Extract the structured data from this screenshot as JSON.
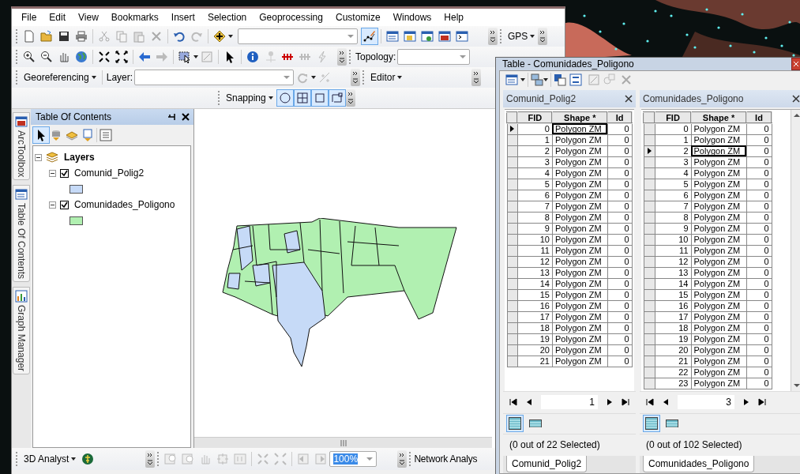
{
  "menu": [
    "File",
    "Edit",
    "View",
    "Bookmarks",
    "Insert",
    "Selection",
    "Geoprocessing",
    "Customize",
    "Windows",
    "Help"
  ],
  "toolbars": {
    "gps": "GPS",
    "topology": "Topology:",
    "georeferencing": "Georeferencing",
    "layer": "Layer:",
    "editor": "Editor",
    "snapping": "Snapping",
    "analyst_3d": "3D Analyst",
    "zoom_value": "100%",
    "network": "Network Analys"
  },
  "side_tabs": [
    {
      "label": "ArcToolbox"
    },
    {
      "label": "Table Of Contents"
    },
    {
      "label": "Graph Manager"
    }
  ],
  "toc": {
    "title": "Table Of Contents",
    "root": {
      "label": "Layers",
      "expanded": true,
      "children": [
        {
          "label": "Comunid_Polig2",
          "checked": true,
          "expanded": true,
          "color": "#c6daf7"
        },
        {
          "label": "Comunidades_Poligono",
          "checked": true,
          "expanded": true,
          "color": "#b1f0b1"
        }
      ]
    }
  },
  "table_window": {
    "title": "Table - Comunidades_Poligono",
    "panes": [
      {
        "title": "Comunid_Polig2",
        "columns": [
          "FID",
          "Shape *",
          "Id"
        ],
        "page": "1",
        "status": "(0 out of 22 Selected)",
        "tab": "Comunid_Polig2",
        "view_buttons": [
          {
            "selected": true
          },
          {
            "selected": false
          }
        ],
        "rows": [
          {
            "cells": [
              "0",
              "Polygon ZM",
              "0"
            ],
            "current": true
          },
          {
            "cells": [
              "1",
              "Polygon ZM",
              "0"
            ],
            "current": false
          },
          {
            "cells": [
              "2",
              "Polygon ZM",
              "0"
            ],
            "current": false
          },
          {
            "cells": [
              "3",
              "Polygon ZM",
              "0"
            ],
            "current": false
          },
          {
            "cells": [
              "4",
              "Polygon ZM",
              "0"
            ],
            "current": false
          },
          {
            "cells": [
              "5",
              "Polygon ZM",
              "0"
            ],
            "current": false
          },
          {
            "cells": [
              "6",
              "Polygon ZM",
              "0"
            ],
            "current": false
          },
          {
            "cells": [
              "7",
              "Polygon ZM",
              "0"
            ],
            "current": false
          },
          {
            "cells": [
              "8",
              "Polygon ZM",
              "0"
            ],
            "current": false
          },
          {
            "cells": [
              "9",
              "Polygon ZM",
              "0"
            ],
            "current": false
          },
          {
            "cells": [
              "10",
              "Polygon ZM",
              "0"
            ],
            "current": false
          },
          {
            "cells": [
              "11",
              "Polygon ZM",
              "0"
            ],
            "current": false
          },
          {
            "cells": [
              "12",
              "Polygon ZM",
              "0"
            ],
            "current": false
          },
          {
            "cells": [
              "13",
              "Polygon ZM",
              "0"
            ],
            "current": false
          },
          {
            "cells": [
              "14",
              "Polygon ZM",
              "0"
            ],
            "current": false
          },
          {
            "cells": [
              "15",
              "Polygon ZM",
              "0"
            ],
            "current": false
          },
          {
            "cells": [
              "16",
              "Polygon ZM",
              "0"
            ],
            "current": false
          },
          {
            "cells": [
              "17",
              "Polygon ZM",
              "0"
            ],
            "current": false
          },
          {
            "cells": [
              "18",
              "Polygon ZM",
              "0"
            ],
            "current": false
          },
          {
            "cells": [
              "19",
              "Polygon ZM",
              "0"
            ],
            "current": false
          },
          {
            "cells": [
              "20",
              "Polygon ZM",
              "0"
            ],
            "current": false
          },
          {
            "cells": [
              "21",
              "Polygon ZM",
              "0"
            ],
            "current": false
          }
        ]
      },
      {
        "title": "Comunidades_Poligono",
        "columns": [
          "FID",
          "Shape *",
          "Id"
        ],
        "page": "3",
        "status": "(0 out of 102 Selected)",
        "tab": "Comunidades_Poligono",
        "view_buttons": [
          {
            "selected": true
          },
          {
            "selected": false
          }
        ],
        "rows": [
          {
            "cells": [
              "0",
              "Polygon ZM",
              "0"
            ],
            "current": false
          },
          {
            "cells": [
              "1",
              "Polygon ZM",
              "0"
            ],
            "current": false
          },
          {
            "cells": [
              "2",
              "Polygon ZM",
              "0"
            ],
            "current": true
          },
          {
            "cells": [
              "3",
              "Polygon ZM",
              "0"
            ],
            "current": false
          },
          {
            "cells": [
              "4",
              "Polygon ZM",
              "0"
            ],
            "current": false
          },
          {
            "cells": [
              "5",
              "Polygon ZM",
              "0"
            ],
            "current": false
          },
          {
            "cells": [
              "6",
              "Polygon ZM",
              "0"
            ],
            "current": false
          },
          {
            "cells": [
              "7",
              "Polygon ZM",
              "0"
            ],
            "current": false
          },
          {
            "cells": [
              "8",
              "Polygon ZM",
              "0"
            ],
            "current": false
          },
          {
            "cells": [
              "9",
              "Polygon ZM",
              "0"
            ],
            "current": false
          },
          {
            "cells": [
              "10",
              "Polygon ZM",
              "0"
            ],
            "current": false
          },
          {
            "cells": [
              "11",
              "Polygon ZM",
              "0"
            ],
            "current": false
          },
          {
            "cells": [
              "12",
              "Polygon ZM",
              "0"
            ],
            "current": false
          },
          {
            "cells": [
              "13",
              "Polygon ZM",
              "0"
            ],
            "current": false
          },
          {
            "cells": [
              "14",
              "Polygon ZM",
              "0"
            ],
            "current": false
          },
          {
            "cells": [
              "15",
              "Polygon ZM",
              "0"
            ],
            "current": false
          },
          {
            "cells": [
              "16",
              "Polygon ZM",
              "0"
            ],
            "current": false
          },
          {
            "cells": [
              "17",
              "Polygon ZM",
              "0"
            ],
            "current": false
          },
          {
            "cells": [
              "18",
              "Polygon ZM",
              "0"
            ],
            "current": false
          },
          {
            "cells": [
              "19",
              "Polygon ZM",
              "0"
            ],
            "current": false
          },
          {
            "cells": [
              "20",
              "Polygon ZM",
              "0"
            ],
            "current": false
          },
          {
            "cells": [
              "21",
              "Polygon ZM",
              "0"
            ],
            "current": false
          },
          {
            "cells": [
              "22",
              "Polygon ZM",
              "0"
            ],
            "current": false
          },
          {
            "cells": [
              "23",
              "Polygon ZM",
              "0"
            ],
            "current": false
          }
        ]
      }
    ]
  }
}
